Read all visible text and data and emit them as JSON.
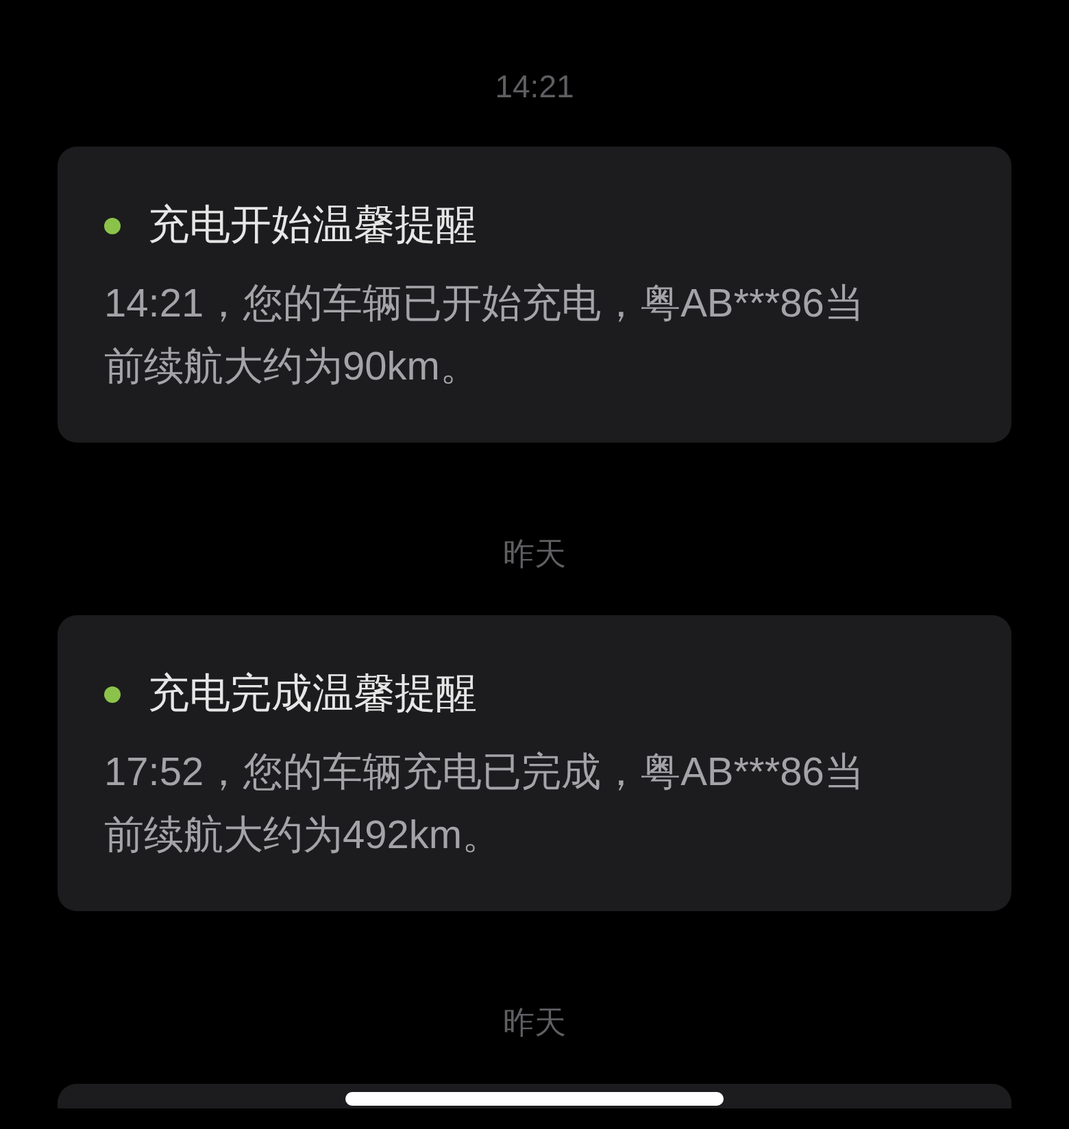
{
  "groups": [
    {
      "date": "14:21",
      "card": {
        "title": "充电开始温馨提醒",
        "body": "14:21，您的车辆已开始充电，粤AB***86当前续航大约为90km。"
      }
    },
    {
      "date": "昨天",
      "card": {
        "title": "充电完成温馨提醒",
        "body": "17:52，您的车辆充电已完成，粤AB***86当前续航大约为492km。"
      }
    },
    {
      "date": "昨天"
    }
  ]
}
